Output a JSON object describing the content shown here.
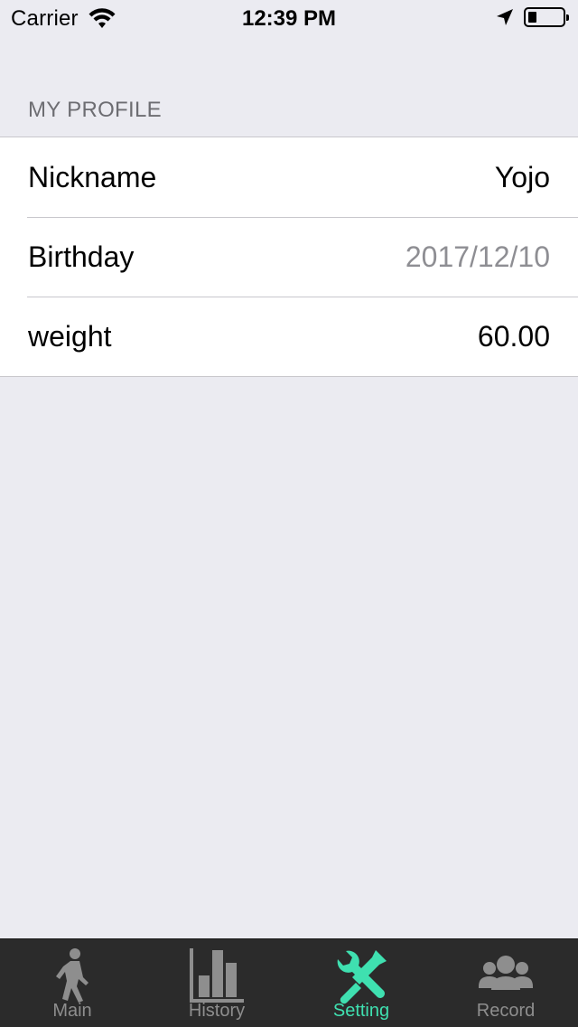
{
  "status_bar": {
    "carrier": "Carrier",
    "time": "12:39 PM",
    "battery_level": 0.25
  },
  "section": {
    "header": "MY PROFILE"
  },
  "profile": {
    "rows": [
      {
        "label": "Nickname",
        "value": "Yojo"
      },
      {
        "label": "Birthday",
        "value": "2017/12/10"
      },
      {
        "label": "weight",
        "value": "60.00"
      }
    ]
  },
  "tab_bar": {
    "active_color": "#3fe0b0",
    "inactive_color": "#8e8e8e",
    "tabs": [
      {
        "label": "Main",
        "icon": "walking-person-icon"
      },
      {
        "label": "History",
        "icon": "bar-chart-icon"
      },
      {
        "label": "Setting",
        "icon": "wrench-screwdriver-icon",
        "active": true
      },
      {
        "label": "Record",
        "icon": "group-users-icon"
      }
    ]
  }
}
